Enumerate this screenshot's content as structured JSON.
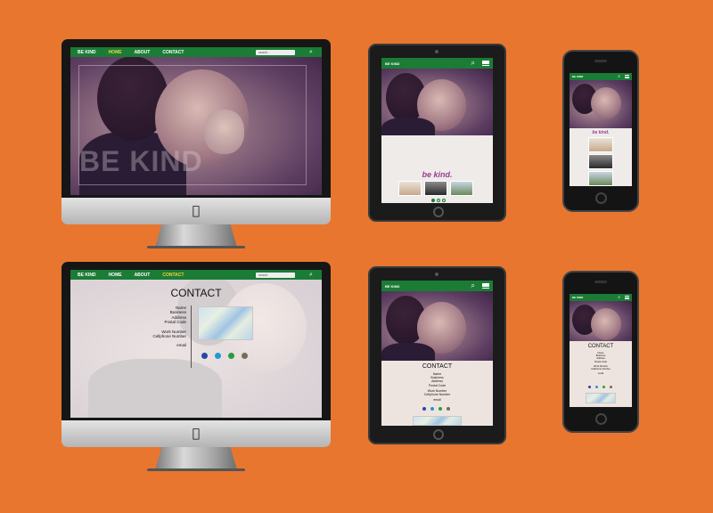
{
  "site": {
    "logo": "BE KIND",
    "nav": [
      "HOME",
      "ABOUT",
      "CONTACT"
    ],
    "search_placeholder": "search",
    "hero_title": "BE KIND",
    "tagline": "be kind.",
    "contact_title": "CONTACT",
    "contact_fields": [
      "Name",
      "Business",
      "Address",
      "Postal Code"
    ],
    "contact_fields_2": [
      "Work Number",
      "Cellphone Number"
    ],
    "contact_email": "email"
  },
  "icons": {
    "apple": "apple-logo-icon",
    "search": "search-icon",
    "menu": "hamburger-menu-icon"
  },
  "colors": {
    "background": "#e9762f",
    "nav_green": "#1b7c36",
    "nav_active": "#f2d53a",
    "tagline_purple": "#9b3d91",
    "social": [
      "#2946a3",
      "#1e9ad6",
      "#2a9b3f",
      "#7a6a5c"
    ]
  }
}
